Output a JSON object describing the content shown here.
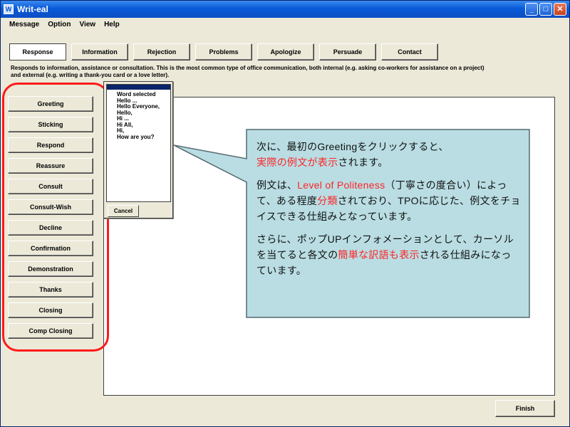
{
  "window": {
    "title": "Writ-eal",
    "icon_name": "app-icon",
    "controls": {
      "minimize": "_",
      "maximize": "□",
      "close": "✕"
    }
  },
  "menu": [
    "Message",
    "Option",
    "View",
    "Help"
  ],
  "tabs": [
    {
      "label": "Response",
      "active": true
    },
    {
      "label": "Information",
      "active": false
    },
    {
      "label": "Rejection",
      "active": false
    },
    {
      "label": "Problems",
      "active": false
    },
    {
      "label": "Apologize",
      "active": false
    },
    {
      "label": "Persuade",
      "active": false
    },
    {
      "label": "Contact",
      "active": false
    }
  ],
  "description": {
    "line1": "Responds to information, assistance or consultation. This is the most common type of office communication, both internal (e.g. asking co-workers for assistance on a project)",
    "line2": "and external (e.g. writing a thank-you card or a love letter)."
  },
  "left_buttons": [
    "Greeting",
    "Sticking",
    "Respond",
    "Reassure",
    "Consult",
    "Consult-Wish",
    "Decline",
    "Confirmation",
    "Demonstration",
    "Thanks",
    "Closing",
    "Comp Closing"
  ],
  "popup": {
    "items": [
      "Word selected",
      "Hello ...",
      "Hello Everyone,",
      "Hello,",
      "Hi ...",
      "Hi All,",
      "Hi,",
      "How are you?"
    ],
    "cancel_label": "Cancel"
  },
  "callout": {
    "p1_a": "次に、最初のGreetingをクリックすると、",
    "p1_b_red": "実際の例文が表示",
    "p1_c": "されます。",
    "p2_a": "例文は、",
    "p2_b_red": "Level of Politeness",
    "p2_c": "（丁寧さの度合い）によって、ある程度",
    "p2_d_red": "分類",
    "p2_e": "されており、TPOに応じた、例文をチョイスできる仕組みとなっています。",
    "p3_a": "さらに、ポップUPインフォメーションとして、カーソルを当てると各文の",
    "p3_b_red": "簡単な訳語も表示",
    "p3_c": "される仕組みになっています。",
    "bg_color": "#b9dde3",
    "highlight_color": "#ff2424"
  },
  "finish_label": "Finish",
  "colors": {
    "annotation_outline": "#ff1a1a"
  }
}
